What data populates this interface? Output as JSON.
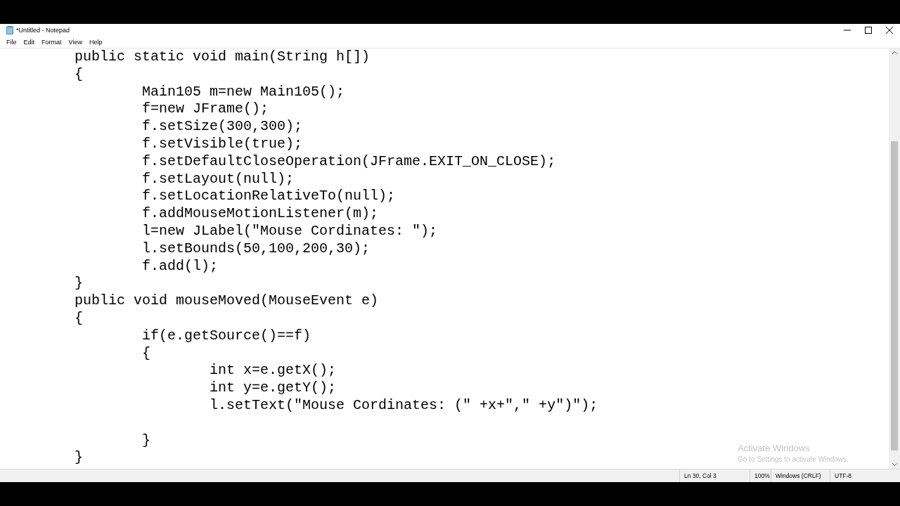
{
  "window": {
    "title": "*Untitled - Notepad"
  },
  "menu": [
    "File",
    "Edit",
    "Format",
    "View",
    "Help"
  ],
  "editor": {
    "text": "\tpublic static void main(String h[])\n\t{\n\t\tMain105 m=new Main105();\n\t\tf=new JFrame();\n\t\tf.setSize(300,300);\n\t\tf.setVisible(true);\n\t\tf.setDefaultCloseOperation(JFrame.EXIT_ON_CLOSE);\n\t\tf.setLayout(null);\n\t\tf.setLocationRelativeTo(null);\n\t\tf.addMouseMotionListener(m);\n\t\tl=new JLabel(\"Mouse Cordinates: \");\n\t\tl.setBounds(50,100,200,30);\n\t\tf.add(l);\n\t}\n\tpublic void mouseMoved(MouseEvent e)\n\t{\n\t\tif(e.getSource()==f)\n\t\t{\n\t\t\tint x=e.getX();\n\t\t\tint y=e.getY();\n\t\t\tl.setText(\"Mouse Cordinates: (\" +x+\",\" +y\")\");\n\n\t\t}\n\t}"
  },
  "activation": {
    "title": "Activate Windows",
    "subtitle": "Go to Settings to activate Windows."
  },
  "status_bar": [
    "Ln 30, Col 3",
    "100%",
    "Windows (CRLF)",
    "UTF-8"
  ]
}
